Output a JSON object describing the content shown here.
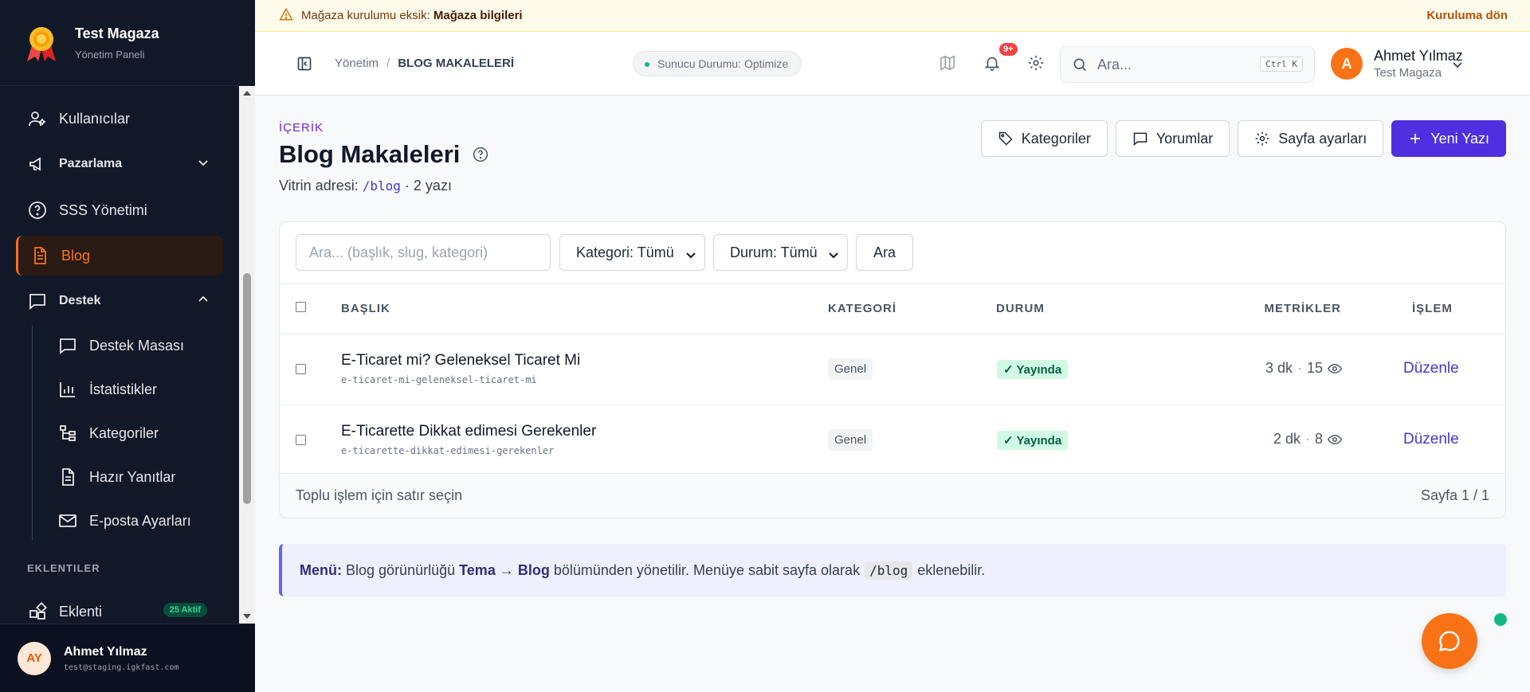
{
  "brand": {
    "title": "Test Magaza",
    "subtitle": "Yönetim Paneli"
  },
  "sidebar": {
    "items": [
      {
        "label": "Kullanıcılar",
        "icon": "users-icon"
      },
      {
        "label": "Pazarlama",
        "icon": "megaphone-icon"
      },
      {
        "label": "SSS Yönetimi",
        "icon": "help-circle-icon"
      },
      {
        "label": "Blog",
        "icon": "document-icon",
        "active": true
      },
      {
        "label": "Destek",
        "icon": "chat-icon"
      }
    ],
    "sub_items": [
      {
        "label": "Destek Masası",
        "icon": "chat-icon"
      },
      {
        "label": "İstatistikler",
        "icon": "bar-chart-icon"
      },
      {
        "label": "Kategoriler",
        "icon": "tree-icon"
      },
      {
        "label": "Hazır Yanıtlar",
        "icon": "document-icon"
      },
      {
        "label": "E-posta Ayarları",
        "icon": "mail-icon"
      }
    ],
    "section_label": "EKLENTILER",
    "plugins": {
      "label": "Eklenti",
      "badge": "25 Aktif"
    }
  },
  "footer_user": {
    "initials": "AY",
    "name": "Ahmet Yılmaz",
    "email": "test@staging.igkfast.com"
  },
  "banner": {
    "prefix": "Mağaza kurulumu eksik:",
    "strong": "Mağaza bilgileri",
    "link": "Kuruluma dön"
  },
  "topbar": {
    "breadcrumb_root": "Yönetim",
    "breadcrumb_sep": "/",
    "breadcrumb_current": "BLOG MAKALELERİ",
    "server_status": "Sunucu Durumu: Optimize",
    "notif_count": "9+",
    "search_placeholder": "Ara...",
    "search_shortcut": "Ctrl K",
    "user_initial": "A",
    "user_name": "Ahmet Yılmaz",
    "user_store": "Test Magaza"
  },
  "page": {
    "eyebrow": "İÇERİK",
    "title": "Blog Makaleleri",
    "subtitle_prefix": "Vitrin adresi:",
    "subtitle_path": "/blog",
    "subtitle_count": "· 2 yazı",
    "actions": [
      "Kategoriler",
      "Yorumlar",
      "Sayfa ayarları",
      "Yeni Yazı"
    ]
  },
  "filters": {
    "search_placeholder": "Ara... (başlık, slug, kategori)",
    "category_select": "Kategori: Tümü",
    "status_select": "Durum: Tümü",
    "search_button": "Ara"
  },
  "table": {
    "columns": [
      "BAŞLIK",
      "KATEGORİ",
      "DURUM",
      "METRİKLER",
      "İŞLEM"
    ],
    "rows": [
      {
        "title": "E-Ticaret mi? Geleneksel Ticaret Mi",
        "slug": "e-ticaret-mi-geleneksel-ticaret-mi",
        "category": "Genel",
        "status": "✓ Yayında",
        "read_time": "3 dk",
        "views": "15",
        "action": "Düzenle"
      },
      {
        "title": "E-Ticarette Dikkat edimesi Gerekenler",
        "slug": "e-ticarette-dikkat-edimesi-gerekenler",
        "category": "Genel",
        "status": "✓ Yayında",
        "read_time": "2 dk",
        "views": "8",
        "action": "Düzenle"
      }
    ],
    "footer_left": "Toplu işlem için satır seçin",
    "footer_right": "Sayfa 1 / 1"
  },
  "info": {
    "label": "Menü:",
    "text1": "Blog görünürlüğü",
    "strong": "Tema → Blog",
    "text2": "bölümünden yönetilir. Menüye sabit sayfa olarak",
    "code": "/blog",
    "text3": "eklenebilir."
  },
  "colors": {
    "accent": "#4f2fe0",
    "brand_orange": "#f97316",
    "sidebar_bg": "#111827",
    "success": "#10b981"
  }
}
